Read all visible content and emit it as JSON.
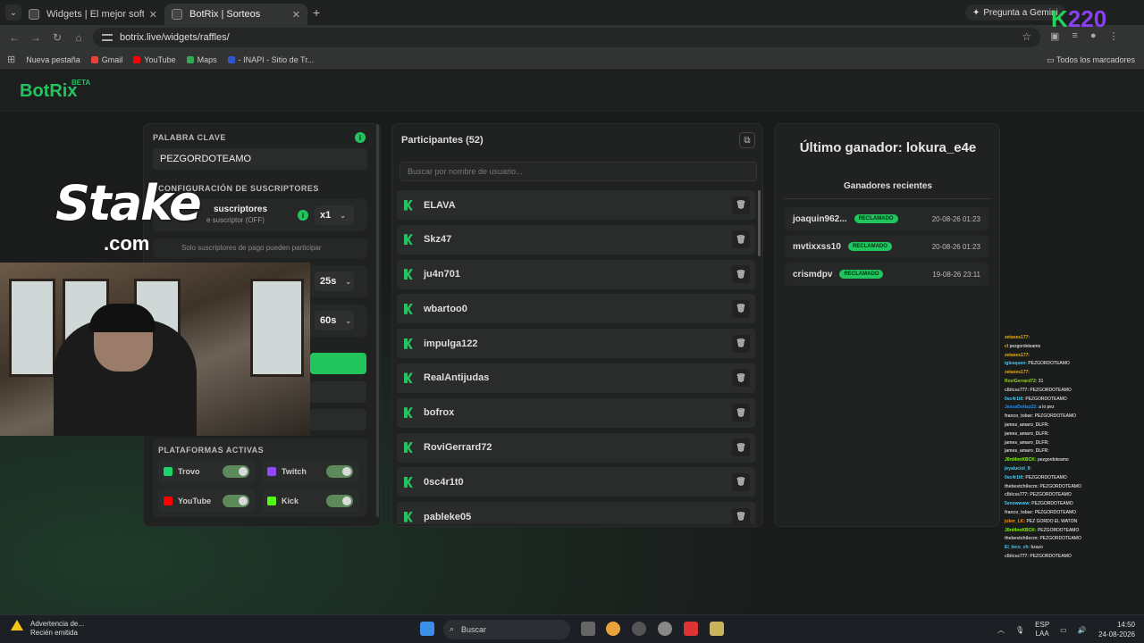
{
  "browser": {
    "tabs": [
      {
        "title": "Widgets | El mejor software par",
        "active": false
      },
      {
        "title": "BotRix | Sorteos",
        "active": true
      }
    ],
    "gemini_label": "Pregunta a Gemini",
    "url": "botrix.live/widgets/raffles/",
    "bookmarks": [
      "Nueva pestaña",
      "Gmail",
      "YouTube",
      "Maps",
      "- INAPI - Sitio de Tr..."
    ],
    "all_bookmarks": "Todos los marcadores"
  },
  "app": {
    "logo": "BotRix",
    "logo_badge": "BETA",
    "accent": "#21c55e"
  },
  "settings": {
    "keyword_label": "PALABRA CLAVE",
    "keyword_value": "PEZGORDOTEAMO",
    "subs_section": "CONFIGURACIÓN DE SUSCRIPTORES",
    "subs_title": "suscriptores",
    "subs_subtitle": "e suscriptor (OFF)",
    "subs_multiplier": "x1",
    "subs_note": "Solo suscriptores de pago pueden participar",
    "timer1": "25s",
    "timer2": "60s",
    "platforms_label": "PLATAFORMAS ACTIVAS",
    "platforms": [
      {
        "name": "Trovo",
        "color": "#19d66b",
        "on": true
      },
      {
        "name": "Twitch",
        "color": "#9146ff",
        "on": true
      },
      {
        "name": "YouTube",
        "color": "#ff0000",
        "on": true
      },
      {
        "name": "Kick",
        "color": "#53fc18",
        "on": true
      }
    ]
  },
  "participants": {
    "title": "Participantes (52)",
    "search_placeholder": "Buscar por nombre de usuario...",
    "list": [
      "ELAVA",
      "Skz47",
      "ju4n701",
      "wbartoo0",
      "impulga122",
      "RealAntijudas",
      "bofrox",
      "RoviGerrard72",
      "0sc4r1t0",
      "pableke05"
    ]
  },
  "winners": {
    "title": "Último ganador: lokura_e4e",
    "recent_label": "Ganadores recientes",
    "recent": [
      {
        "name": "joaquin962...",
        "badge": "RECLAMADO",
        "date": "20-08-26 01:23"
      },
      {
        "name": "mvtixxss10",
        "badge": "RECLAMADO",
        "date": "20-08-26 01:23"
      },
      {
        "name": "crismdpv",
        "badge": "RECLAMADO",
        "date": "19-08-26 23:11"
      }
    ]
  },
  "overlay": {
    "stake_text": "Stake",
    "stake_com": ".com",
    "k_logo": "K",
    "k_number": "220"
  },
  "chat": [
    {
      "user": "zetaxes177:",
      "msg": "",
      "color": "#f0b000"
    },
    {
      "user": "cl",
      "msg": "pezgordoteamo",
      "color": "#f0b000"
    },
    {
      "user": "zetaxes177:",
      "msg": "",
      "color": "#f0b000"
    },
    {
      "user": "iglesquen:",
      "msg": "PEZGORDOTEAMO",
      "color": "#4cc9f0"
    },
    {
      "user": "zetaxes177:",
      "msg": "",
      "color": "#f0b000"
    },
    {
      "user": "RoviGerrard72:",
      "msg": "31",
      "color": "#9acd32"
    },
    {
      "user": "clblcss777:",
      "msg": "PEZGORDOTEAMO",
      "color": "#cccccc"
    },
    {
      "user": "0sc4r1t0:",
      "msg": "PEZGORDOTEAMO",
      "color": "#4cc9f0"
    },
    {
      "user": "JesusDottaz22:",
      "msg": "a lo pez",
      "color": "#1e90ff"
    },
    {
      "user": "franco_tobar:",
      "msg": "PEZGORDOTEAMO",
      "color": "#cccccc"
    },
    {
      "user": "james_amaro_DLFR:",
      "msg": "",
      "color": "#cccccc"
    },
    {
      "user": "james_amaro_DLFR:",
      "msg": "",
      "color": "#cccccc"
    },
    {
      "user": "james_amaro_DLFR:",
      "msg": "",
      "color": "#cccccc"
    },
    {
      "user": "james_amaro_DLFR:",
      "msg": "",
      "color": "#cccccc"
    },
    {
      "user": "J0rd4nnKBCK:",
      "msg": "pezgordoteamo",
      "color": "#7cfc00"
    },
    {
      "user": "jeyaluciol_9:",
      "msg": "",
      "color": "#4cc9f0"
    },
    {
      "user": "0sc4r1t0:",
      "msg": "PEZGORDOTEAMO",
      "color": "#4cc9f0"
    },
    {
      "user": "thebestchilecm:",
      "msg": "PEZGORDOTEAMO",
      "color": "#cccccc"
    },
    {
      "user": "clblcss777:",
      "msg": "PEZGORDOTEAMO",
      "color": "#cccccc"
    },
    {
      "user": "5snowwww:",
      "msg": "PEZGORDOTEAMO",
      "color": "#4cc9f0"
    },
    {
      "user": "franco_tobar:",
      "msg": "PEZGORDOTEAMO",
      "color": "#cccccc"
    },
    {
      "user": "joker_LK:",
      "msg": "PEZ GORDO EL WATON",
      "color": "#ff8c00"
    },
    {
      "user": "J0rd4nnKBCK:",
      "msg": "PEZGORDOTEAMO",
      "color": "#7cfc00"
    },
    {
      "user": "thebestchilecm:",
      "msg": "PEZGORDOTEAMO",
      "color": "#cccccc"
    },
    {
      "user": "El_loco_ch:",
      "msg": "bzazo",
      "color": "#4cc9f0"
    },
    {
      "user": "clblcss777:",
      "msg": "PEZGORDOTEAMO",
      "color": "#cccccc"
    }
  ],
  "taskbar": {
    "warning_title": "Advertencia de...",
    "warning_sub": "Recién emitida",
    "search": "Buscar",
    "lang": "ESP",
    "lang_sub": "LAA",
    "time": "14:50",
    "date": "24-08-2026"
  }
}
